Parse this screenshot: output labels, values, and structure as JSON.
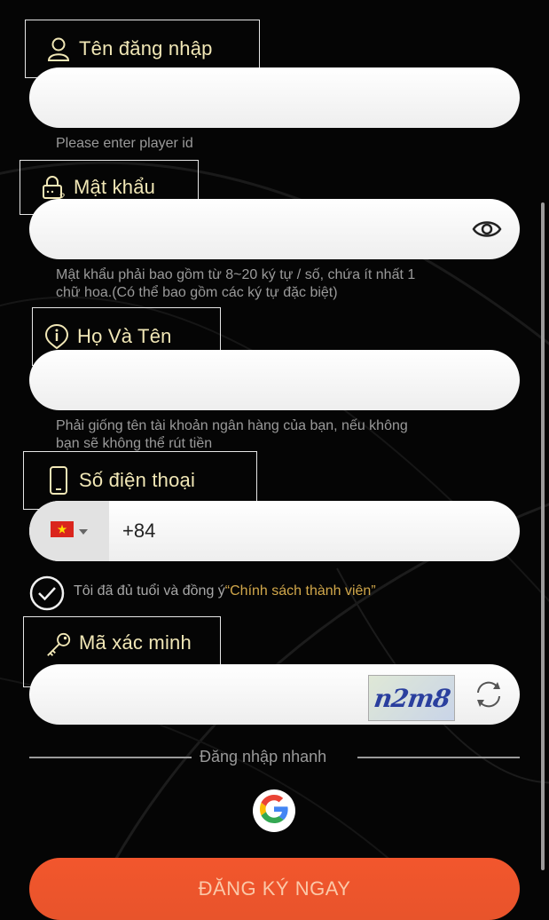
{
  "username": {
    "label": "Tên đăng nhập",
    "hint": "Please enter player id",
    "value": ""
  },
  "password": {
    "label": "Mật khẩu",
    "hint_line1": "Mật khẩu phải bao gồm từ 8~20 ký tự / số, chứa ít nhất 1",
    "hint_line2": "chữ hoa.(Có thể bao gồm các ký tự đặc biệt)",
    "value": ""
  },
  "fullname": {
    "label": "Họ Và Tên",
    "hint_line1": "Phải giống tên tài khoản ngân hàng của bạn, nếu không",
    "hint_line2": "bạn sẽ không thể rút tiền",
    "value": ""
  },
  "phone": {
    "label": "Số điện thoại",
    "country_code": "+84",
    "flag": "vietnam-flag-icon"
  },
  "agreement": {
    "text": "Tôi đã đủ tuổi và đồng ý ",
    "link": "“Chính sách thành viên”",
    "checked": true
  },
  "captcha": {
    "label": "Mã xác minh",
    "code": "n2m8",
    "value": ""
  },
  "quick_login": {
    "label": "Đăng nhập nhanh"
  },
  "submit": {
    "label": "ĐĂNG KÝ NGAY"
  },
  "colors": {
    "label_text": "#f1e7b6",
    "accent_link": "#d2a84b",
    "submit_bg": "#e8542b"
  }
}
